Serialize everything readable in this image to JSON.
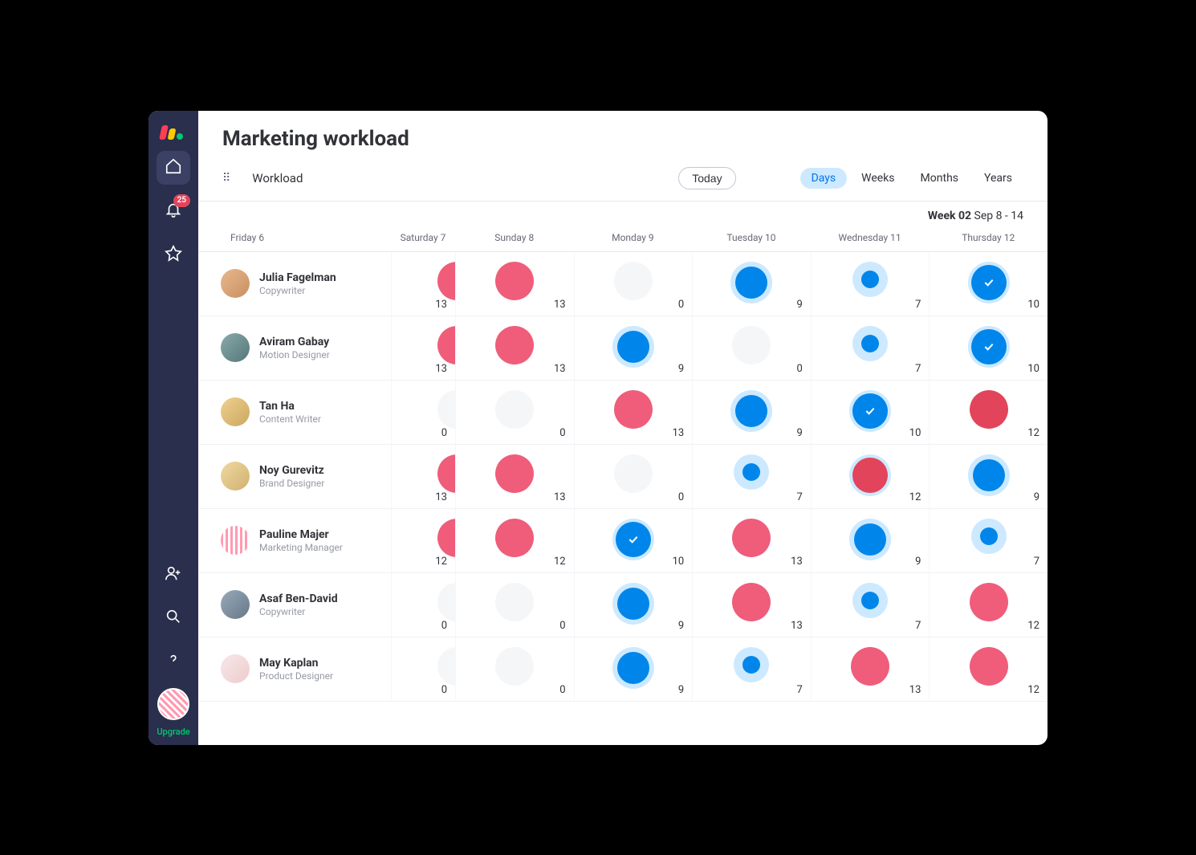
{
  "sidebar": {
    "notification_count": "25",
    "upgrade_label": "Upgrade"
  },
  "header": {
    "title": "Marketing workload"
  },
  "toolbar": {
    "view_label": "Workload",
    "today_label": "Today",
    "ranges": [
      "Days",
      "Weeks",
      "Months",
      "Years"
    ],
    "active_range_index": 0
  },
  "week_banner": {
    "bold": "Week 02",
    "rest": " Sep 8 - 14"
  },
  "columns": [
    "Friday 6",
    "Saturday 7",
    "Sunday 8",
    "Monday 9",
    "Tuesday 10",
    "Wednesday 11",
    "Thursday 12"
  ],
  "colors": {
    "pink": "#ef5d7a",
    "red": "#e2445c",
    "blue": "#0086ea",
    "ring": "#cce9ff",
    "empty": "#f5f6f8"
  },
  "people": [
    {
      "name": "Julia Fagelman",
      "role": "Copywriter",
      "avatar_class": "c0",
      "cells": [
        {
          "value": 13,
          "style": "pink-full",
          "clip": true
        },
        {
          "value": 13,
          "style": "pink-full"
        },
        {
          "value": 0,
          "style": "empty"
        },
        {
          "value": 9,
          "style": "blue-ring-large"
        },
        {
          "value": 7,
          "style": "blue-ring-small"
        },
        {
          "value": 10,
          "style": "blue-check"
        }
      ]
    },
    {
      "name": "Aviram Gabay",
      "role": "Motion Designer",
      "avatar_class": "c1",
      "cells": [
        {
          "value": 13,
          "style": "pink-full",
          "clip": true
        },
        {
          "value": 13,
          "style": "pink-full"
        },
        {
          "value": 9,
          "style": "blue-ring-large"
        },
        {
          "value": 0,
          "style": "empty"
        },
        {
          "value": 7,
          "style": "blue-ring-small"
        },
        {
          "value": 10,
          "style": "blue-check"
        }
      ]
    },
    {
      "name": "Tan Ha",
      "role": "Content Writer",
      "avatar_class": "c2",
      "cells": [
        {
          "value": 0,
          "style": "empty",
          "clip": true
        },
        {
          "value": 0,
          "style": "empty"
        },
        {
          "value": 13,
          "style": "pink-full"
        },
        {
          "value": 9,
          "style": "blue-ring-large"
        },
        {
          "value": 10,
          "style": "blue-check"
        },
        {
          "value": 12,
          "style": "red-full"
        }
      ]
    },
    {
      "name": "Noy Gurevitz",
      "role": "Brand Designer",
      "avatar_class": "c3",
      "cells": [
        {
          "value": 13,
          "style": "pink-full",
          "clip": true
        },
        {
          "value": 13,
          "style": "pink-full"
        },
        {
          "value": 0,
          "style": "empty"
        },
        {
          "value": 7,
          "style": "blue-ring-small"
        },
        {
          "value": 12,
          "style": "red-ring"
        },
        {
          "value": 9,
          "style": "blue-ring-large"
        }
      ]
    },
    {
      "name": "Pauline Majer",
      "role": "Marketing Manager",
      "avatar_class": "c4",
      "cells": [
        {
          "value": 12,
          "style": "pink-full",
          "clip": true
        },
        {
          "value": 12,
          "style": "pink-full"
        },
        {
          "value": 10,
          "style": "blue-check"
        },
        {
          "value": 13,
          "style": "pink-full"
        },
        {
          "value": 9,
          "style": "blue-ring-large"
        },
        {
          "value": 7,
          "style": "blue-ring-small"
        }
      ]
    },
    {
      "name": "Asaf Ben-David",
      "role": "Copywriter",
      "avatar_class": "c5",
      "cells": [
        {
          "value": 0,
          "style": "empty",
          "clip": true
        },
        {
          "value": 0,
          "style": "empty"
        },
        {
          "value": 9,
          "style": "blue-ring-large"
        },
        {
          "value": 13,
          "style": "pink-full"
        },
        {
          "value": 7,
          "style": "blue-ring-small"
        },
        {
          "value": 12,
          "style": "pink-full"
        }
      ]
    },
    {
      "name": "May Kaplan",
      "role": "Product Designer",
      "avatar_class": "c6",
      "cells": [
        {
          "value": 0,
          "style": "empty",
          "clip": true
        },
        {
          "value": 0,
          "style": "empty"
        },
        {
          "value": 9,
          "style": "blue-ring-large"
        },
        {
          "value": 7,
          "style": "blue-ring-small"
        },
        {
          "value": 13,
          "style": "pink-full"
        },
        {
          "value": 12,
          "style": "pink-full"
        }
      ]
    }
  ]
}
